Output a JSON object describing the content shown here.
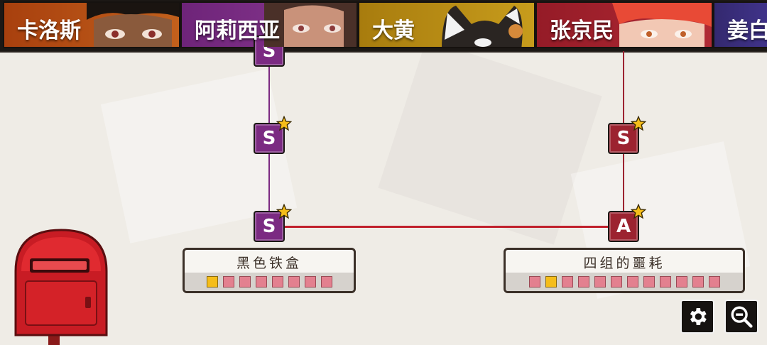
{
  "characters": [
    {
      "name": "卡洛斯",
      "color": "#b44a12",
      "portrait": "dark-hair-man-portrait"
    },
    {
      "name": "阿莉西亚",
      "color": "#7a2d86",
      "portrait": "long-hair-woman-portrait"
    },
    {
      "name": "大黄",
      "color": "#b88a10",
      "portrait": "cat-portrait"
    },
    {
      "name": "张京民",
      "color": "#9b1e2a",
      "portrait": "red-hair-man-portrait"
    },
    {
      "name": "姜白",
      "color": "#3b2f80",
      "portrait": "portrait"
    }
  ],
  "nodes": [
    {
      "rank": "S",
      "color": "#7b2a82",
      "starred": false
    },
    {
      "rank": "S",
      "color": "#7b2a82",
      "starred": true
    },
    {
      "rank": "S",
      "color": "#7b2a82",
      "starred": true
    },
    {
      "rank": "S",
      "color": "#9c2330",
      "starred": true
    },
    {
      "rank": "A",
      "color": "#9c2330",
      "starred": true
    }
  ],
  "events": [
    {
      "title": "黑色铁盒",
      "segments": 8,
      "highlighted": [
        0
      ]
    },
    {
      "title": "四组的噩耗",
      "segments": 12,
      "highlighted": [
        1
      ]
    }
  ],
  "colors": {
    "purple_line": "#7b2a82",
    "red_line": "#c0202c",
    "highlight": "#f5bd1a"
  },
  "controls": {
    "settings_icon": "gear-icon",
    "zoom_icon": "zoom-out-icon"
  }
}
